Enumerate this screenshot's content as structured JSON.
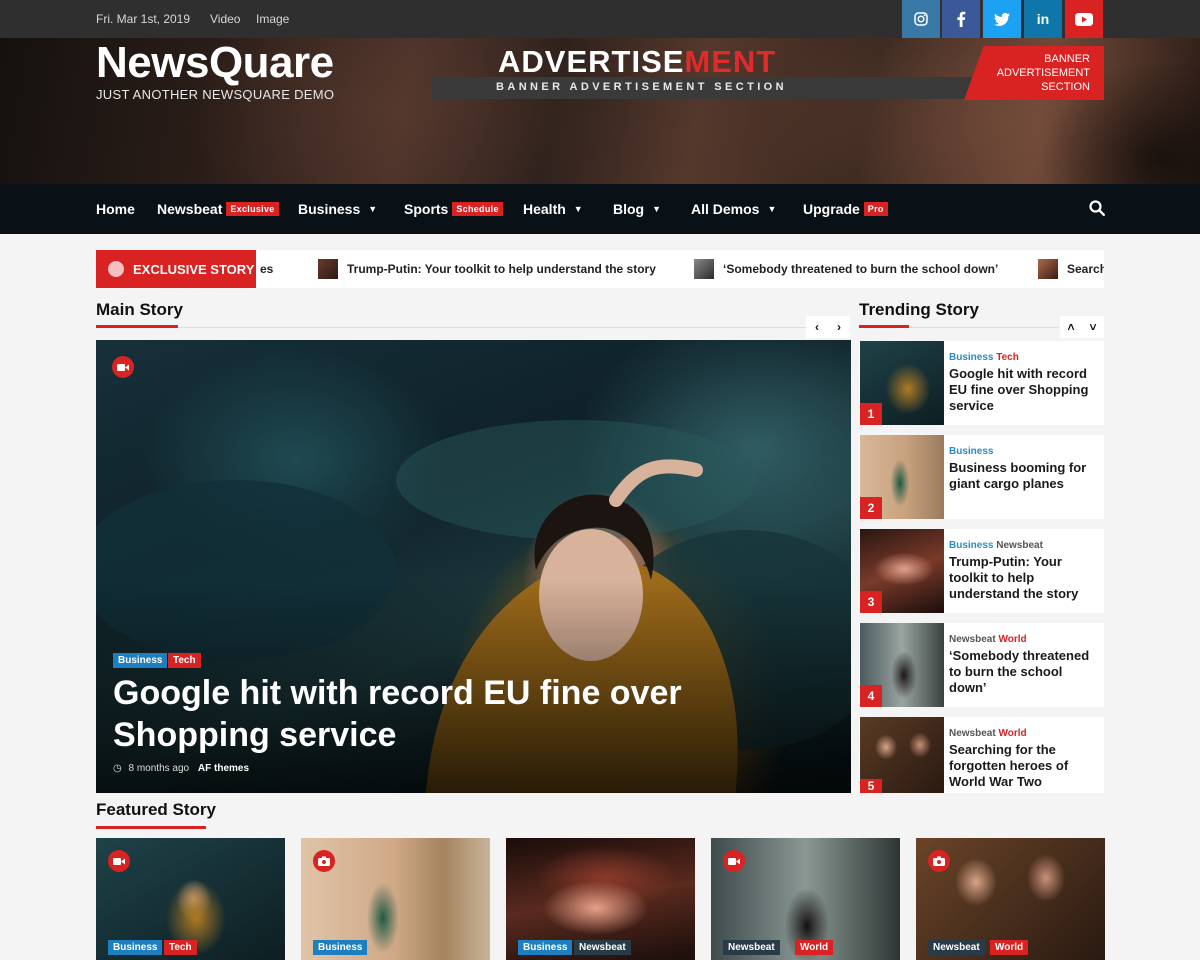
{
  "topbar": {
    "date": "Fri. Mar 1st, 2019",
    "links": [
      "Video",
      "Image"
    ],
    "social": [
      {
        "icon": "instagram-icon",
        "glyph": "◎",
        "color": "#3a78a8"
      },
      {
        "icon": "facebook-icon",
        "glyph": "f",
        "color": "#3b5998"
      },
      {
        "icon": "twitter-icon",
        "glyph": "✦",
        "color": "#1da1f2"
      },
      {
        "icon": "linkedin-icon",
        "glyph": "in",
        "color": "#0e76a8"
      },
      {
        "icon": "youtube-icon",
        "glyph": "▶",
        "color": "#d92222"
      }
    ]
  },
  "header": {
    "site_title": "NewsQuare",
    "tagline": "JUST ANOTHER NEWSQUARE DEMO",
    "ad_title_a": "ADVERTISE",
    "ad_title_b": "MENT",
    "ad_subtitle": "BANNER ADVERTISEMENT SECTION",
    "ad_box": [
      "BANNER",
      "ADVERTISEMENT",
      "SECTION"
    ]
  },
  "nav": {
    "items": [
      {
        "label": "Home"
      },
      {
        "label": "Newsbeat",
        "badge": "Exclusive"
      },
      {
        "label": "Business"
      },
      {
        "label": "Sports",
        "badge": "Schedule"
      },
      {
        "label": "Health"
      },
      {
        "label": "Blog"
      },
      {
        "label": "All Demos"
      },
      {
        "label": "Upgrade",
        "badge": "Pro"
      }
    ]
  },
  "ticker": {
    "label": "EXCLUSIVE STORY",
    "items": [
      "es",
      "Trump-Putin: Your toolkit to help understand the story",
      "‘Somebody threatened to burn the school down’",
      "Search"
    ]
  },
  "main": {
    "section_title": "Main Story",
    "categories": [
      "Business",
      "Tech"
    ],
    "headline": "Google hit with record EU fine over Shopping service",
    "time": "8 months ago",
    "author": "AF themes"
  },
  "trending": {
    "section_title": "Trending Story",
    "items": [
      {
        "num": "1",
        "cats": [
          "Business",
          "Tech"
        ],
        "title": "Google hit with record EU fine over Shopping service"
      },
      {
        "num": "2",
        "cats": [
          "Business"
        ],
        "title": "Business booming for giant cargo planes"
      },
      {
        "num": "3",
        "cats": [
          "Business",
          "Newsbeat"
        ],
        "title": "Trump-Putin: Your toolkit to help understand the story"
      },
      {
        "num": "4",
        "cats": [
          "Newsbeat",
          "World"
        ],
        "title": "‘Somebody threatened to burn the school down’"
      },
      {
        "num": "5",
        "cats": [
          "Newsbeat",
          "World"
        ],
        "title": "Searching for the forgotten heroes of World War Two"
      }
    ]
  },
  "featured": {
    "section_title": "Featured Story",
    "items": [
      {
        "cats": [
          "Business",
          "Tech"
        ],
        "media": "video"
      },
      {
        "cats": [
          "Business"
        ],
        "media": "camera"
      },
      {
        "cats": [
          "Business",
          "Newsbeat"
        ],
        "media": "none"
      },
      {
        "cats": [
          "Newsbeat",
          "World"
        ],
        "media": "video"
      },
      {
        "cats": [
          "Newsbeat",
          "World"
        ],
        "media": "camera"
      }
    ]
  },
  "colors": {
    "accent": "#d92222",
    "business": "#1e7fc0",
    "newsbeat": "#2a3b48",
    "nav_bg": "#0a1116"
  }
}
